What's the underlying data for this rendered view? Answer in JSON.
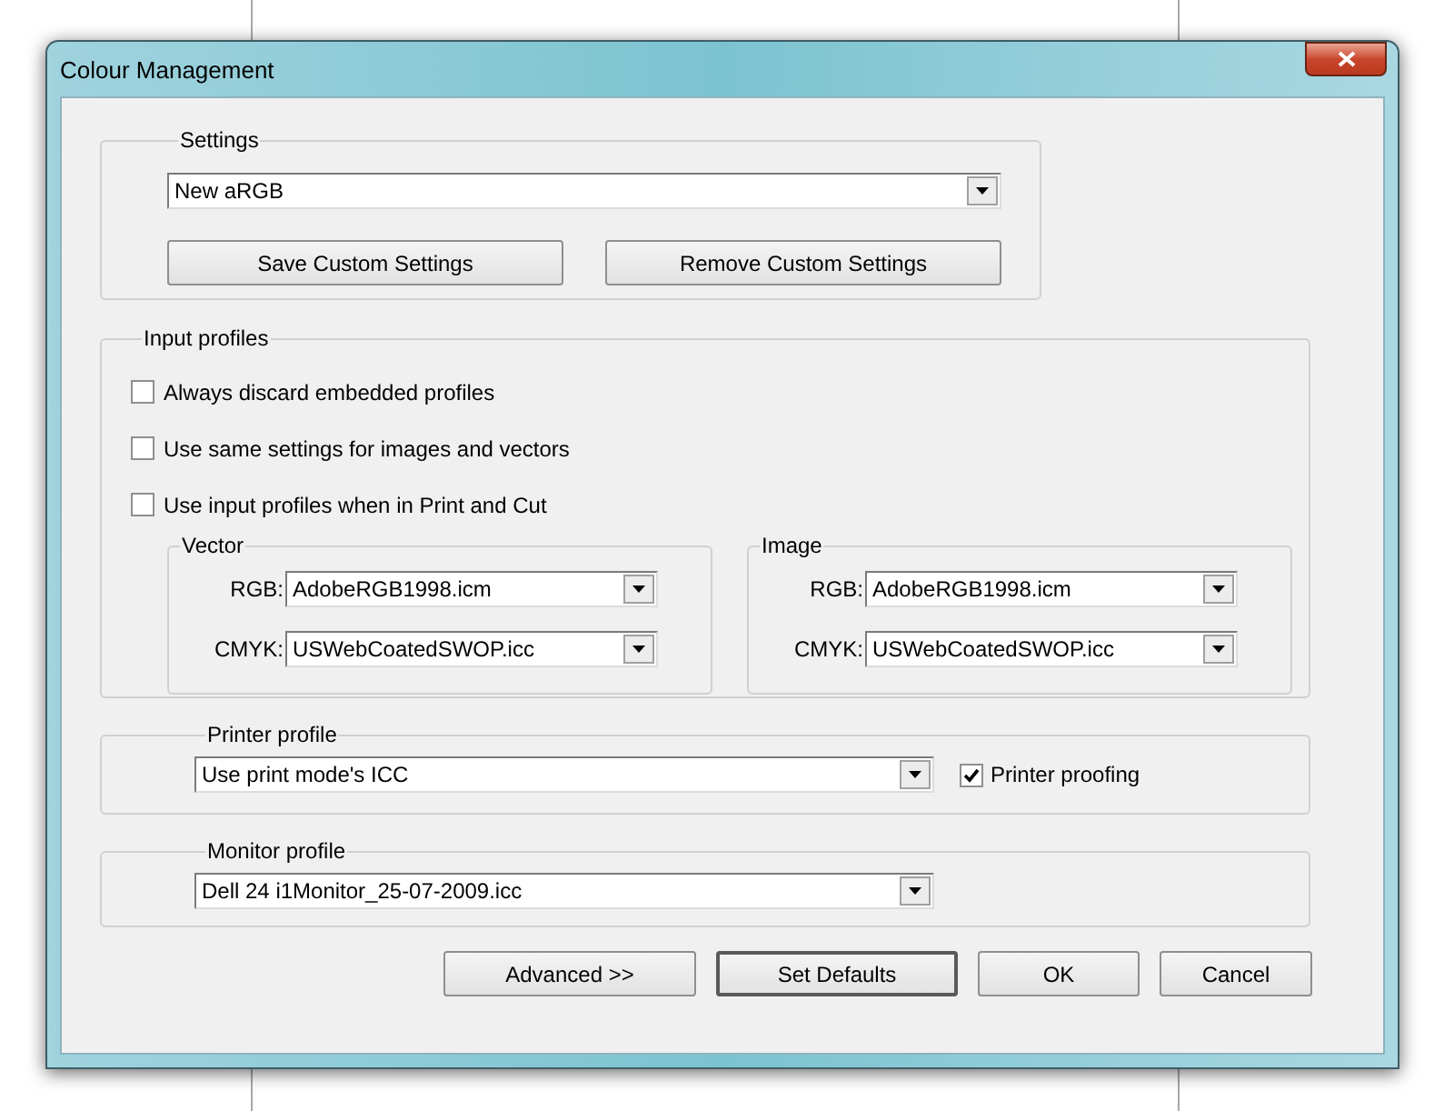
{
  "window": {
    "title": "Colour Management"
  },
  "settings": {
    "label": "Settings",
    "preset": "New aRGB",
    "buttons": [
      "Save Custom Settings",
      "Remove Custom Settings"
    ]
  },
  "input_profiles": {
    "label": "Input profiles",
    "options": [
      {
        "label": "Always discard embedded profiles",
        "checked": false
      },
      {
        "label": "Use same settings for images and vectors",
        "checked": false
      },
      {
        "label": "Use input profiles when in Print and Cut",
        "checked": false
      }
    ],
    "groups": [
      {
        "label": "Vector",
        "rows": [
          {
            "label": "RGB:",
            "value": "AdobeRGB1998.icm"
          },
          {
            "label": "CMYK:",
            "value": "USWebCoatedSWOP.icc"
          }
        ]
      },
      {
        "label": "Image",
        "rows": [
          {
            "label": "RGB:",
            "value": "AdobeRGB1998.icm"
          },
          {
            "label": "CMYK:",
            "value": "USWebCoatedSWOP.icc"
          }
        ]
      }
    ]
  },
  "printer_profile": {
    "label": "Printer profile",
    "value": "Use print mode's ICC",
    "proofing": {
      "label": "Printer proofing",
      "checked": true
    }
  },
  "monitor_profile": {
    "label": "Monitor profile",
    "value": "Dell 24 i1Monitor_25-07-2009.icc"
  },
  "buttons": [
    {
      "label": "Advanced >>",
      "focused": false
    },
    {
      "label": "Set Defaults",
      "focused": true
    },
    {
      "label": "OK",
      "focused": false
    },
    {
      "label": "Cancel",
      "focused": false
    }
  ]
}
